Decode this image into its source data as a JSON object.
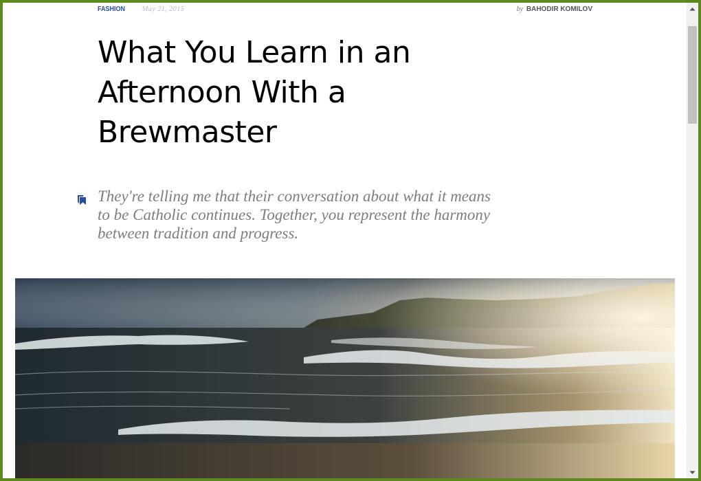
{
  "article": {
    "category": "FASHION",
    "date": "May 21, 2015",
    "author_prefix": "by",
    "author": "BAHODIR KOMILOV",
    "title": "What You Learn in an Afternoon With a Brewmaster",
    "quote": "They're telling me that their conversation about what it means to be Catholic continues. Together, you represent the harmony between tradition and progress.",
    "quote_icon": "bookmark-icon",
    "hero_image": "ocean-waves-sunset-photo"
  },
  "colors": {
    "accent": "#2a4e9c",
    "window_border": "#5d8a1e",
    "quote_text": "#7d7d7d"
  }
}
